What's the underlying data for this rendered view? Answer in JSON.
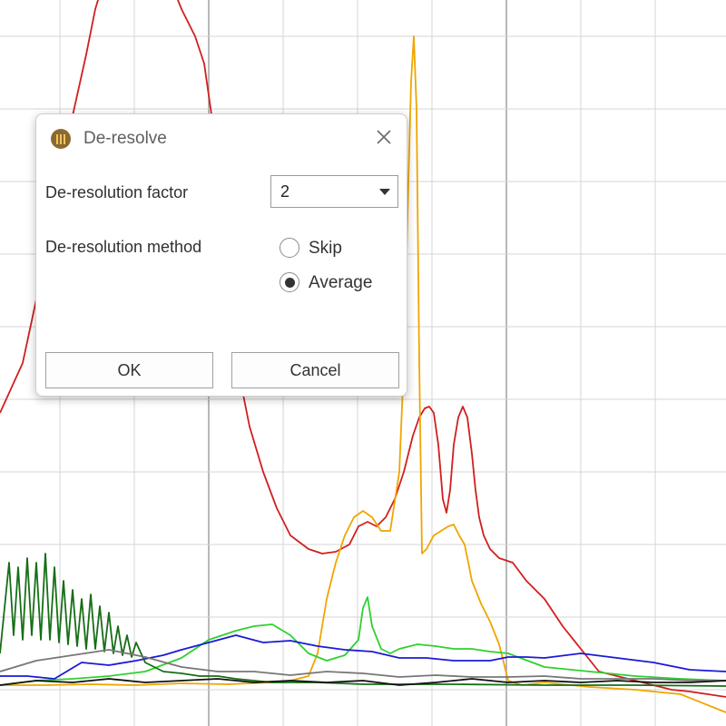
{
  "dialog": {
    "title": "De-resolve",
    "factor_label": "De-resolution factor",
    "factor_value": "2",
    "method_label": "De-resolution method",
    "options": [
      {
        "label": "Skip",
        "selected": false
      },
      {
        "label": "Average",
        "selected": true
      }
    ],
    "ok_label": "OK",
    "cancel_label": "Cancel"
  },
  "icons": {
    "app": "app-logo-icon",
    "close": "close-icon",
    "dropdown": "chevron-down-icon"
  },
  "chart_data": {
    "type": "line",
    "title": "",
    "xlabel": "",
    "ylabel": "",
    "grid": true,
    "series": [
      {
        "color": "#d11f1f",
        "x": [
          0,
          25,
          40,
          60,
          75,
          95,
          105,
          120,
          140,
          160,
          180,
          200,
          215,
          225,
          235,
          245,
          255,
          265,
          275,
          290,
          305,
          320,
          340,
          355,
          370,
          385,
          395,
          405,
          415,
          425,
          435,
          445,
          455,
          462,
          468,
          473,
          478,
          483,
          488,
          492,
          496,
          500,
          505,
          510,
          515,
          520,
          524,
          528,
          533,
          540,
          550,
          565,
          580,
          600,
          620,
          640,
          660,
          680,
          700,
          720,
          740,
          760,
          780,
          800
        ],
        "y": [
          455,
          400,
          330,
          230,
          150,
          60,
          10,
          -40,
          -60,
          -60,
          -40,
          10,
          40,
          70,
          140,
          250,
          330,
          420,
          470,
          520,
          560,
          590,
          605,
          610,
          608,
          600,
          580,
          575,
          580,
          570,
          550,
          520,
          480,
          460,
          450,
          448,
          455,
          490,
          550,
          565,
          540,
          490,
          460,
          448,
          460,
          500,
          540,
          570,
          590,
          605,
          615,
          620,
          640,
          660,
          690,
          715,
          740,
          745,
          750,
          755,
          760,
          762,
          765,
          768
        ]
      },
      {
        "color": "#f0a500",
        "x": [
          0,
          50,
          100,
          150,
          200,
          250,
          300,
          320,
          340,
          350,
          360,
          370,
          380,
          390,
          400,
          410,
          420,
          430,
          440,
          445,
          450,
          453,
          456,
          459,
          462,
          465,
          470,
          478,
          486,
          494,
          500,
          506,
          512,
          520,
          530,
          540,
          550,
          560,
          575,
          600,
          650,
          700,
          750,
          800
        ],
        "y": [
          755,
          755,
          754,
          755,
          753,
          754,
          752,
          750,
          745,
          720,
          660,
          620,
          590,
          570,
          563,
          570,
          585,
          585,
          520,
          400,
          200,
          90,
          40,
          120,
          400,
          610,
          605,
          590,
          585,
          580,
          578,
          590,
          600,
          640,
          665,
          685,
          710,
          750,
          755,
          752,
          757,
          760,
          765,
          785
        ]
      },
      {
        "color": "#2ed12e",
        "x": [
          0,
          40,
          80,
          120,
          160,
          200,
          230,
          260,
          280,
          300,
          320,
          340,
          360,
          380,
          395,
          400,
          405,
          410,
          420,
          430,
          440,
          460,
          480,
          500,
          520,
          540,
          560,
          600,
          650,
          700,
          750,
          800
        ],
        "y": [
          755,
          750,
          748,
          745,
          740,
          725,
          705,
          695,
          690,
          688,
          700,
          720,
          728,
          722,
          705,
          670,
          658,
          690,
          715,
          720,
          715,
          710,
          712,
          715,
          715,
          718,
          720,
          735,
          740,
          745,
          748,
          750
        ]
      },
      {
        "color": "#1a1ad6",
        "x": [
          0,
          30,
          60,
          90,
          120,
          150,
          180,
          200,
          230,
          260,
          290,
          320,
          350,
          380,
          410,
          440,
          470,
          500,
          520,
          540,
          560,
          580,
          600,
          640,
          680,
          720,
          760,
          800
        ],
        "y": [
          745,
          745,
          748,
          730,
          733,
          728,
          722,
          716,
          708,
          700,
          708,
          706,
          712,
          716,
          718,
          725,
          725,
          728,
          728,
          728,
          724,
          724,
          725,
          720,
          725,
          730,
          738,
          740
        ]
      },
      {
        "color": "#166e16",
        "x": [
          0,
          10,
          15,
          20,
          25,
          30,
          35,
          40,
          45,
          50,
          55,
          60,
          65,
          70,
          75,
          80,
          85,
          90,
          95,
          100,
          105,
          110,
          115,
          120,
          125,
          130,
          135,
          140,
          145,
          150,
          160,
          180,
          200,
          220,
          240,
          260,
          280,
          300,
          350,
          400,
          500,
          600,
          700,
          800
        ],
        "y": [
          720,
          620,
          700,
          625,
          705,
          615,
          700,
          620,
          705,
          610,
          705,
          625,
          708,
          640,
          710,
          650,
          712,
          660,
          715,
          655,
          715,
          668,
          718,
          675,
          720,
          690,
          722,
          700,
          724,
          708,
          730,
          740,
          742,
          745,
          745,
          748,
          750,
          752,
          752,
          754,
          754,
          755,
          755,
          756
        ]
      },
      {
        "color": "#777777",
        "x": [
          0,
          40,
          80,
          120,
          160,
          200,
          240,
          280,
          320,
          360,
          400,
          440,
          480,
          520,
          560,
          600,
          640,
          680,
          720,
          760,
          800
        ],
        "y": [
          740,
          728,
          722,
          716,
          724,
          735,
          740,
          740,
          744,
          740,
          742,
          746,
          744,
          746,
          746,
          745,
          748,
          748,
          748,
          750,
          750
        ]
      },
      {
        "color": "#111111",
        "x": [
          0,
          40,
          80,
          120,
          160,
          200,
          240,
          280,
          320,
          360,
          400,
          440,
          480,
          520,
          560,
          600,
          640,
          680,
          720,
          760,
          800
        ],
        "y": [
          755,
          750,
          752,
          748,
          752,
          750,
          748,
          752,
          750,
          752,
          750,
          755,
          752,
          748,
          752,
          750,
          752,
          750,
          752,
          752,
          750
        ]
      }
    ]
  }
}
